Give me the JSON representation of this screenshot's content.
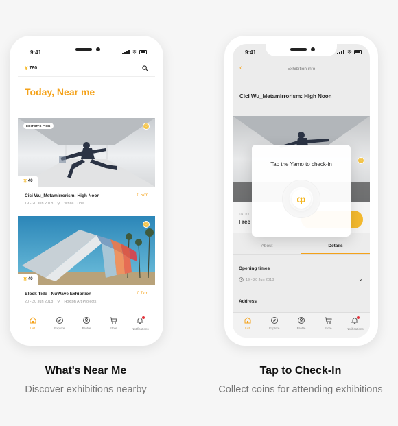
{
  "status_time": "9:41",
  "left": {
    "coins": "760",
    "heading": "Today, Near me",
    "cards": [
      {
        "badge": "EDITOR'S PICK",
        "coins": "40",
        "title": "Cici Wu_Metamirrorism: High Noon",
        "distance": "0.5km",
        "dates": "19 - 20 Jun 2018",
        "venue": "White Cube"
      },
      {
        "coins": "40",
        "title": "Block Tide : NuWave Exhibition",
        "distance": "0.7km",
        "dates": "20 - 30 Jun 2018",
        "venue": "Hoxton Art Projects"
      }
    ]
  },
  "tabs": [
    "List",
    "Explore",
    "Profile",
    "Store",
    "Notifications"
  ],
  "right": {
    "header": "Exhibition info",
    "title": "Cici Wu_Metamirrorism: High Noon",
    "entry_label": "ENTRY",
    "entry_value": "Free",
    "checkin_prompt": "Tap the Yamo to check-in",
    "tabs": [
      "About",
      "Details"
    ],
    "opening_label": "Opening times",
    "opening_value": "19 - 20 Jun 2018",
    "address_label": "Address"
  },
  "captions": {
    "left_title": "What's Near Me",
    "left_sub": "Discover exhibitions nearby",
    "right_title": "Tap to Check-In",
    "right_sub": "Collect coins for attending exhibitions"
  },
  "colors": {
    "accent": "#f4a21a",
    "coin": "#f4b41a",
    "notification_dot": "#e3343c"
  },
  "icons": [
    "coin-icon",
    "search-icon",
    "heart-icon",
    "pin-icon",
    "clock-icon",
    "back-icon",
    "chevron-down-icon",
    "list-icon",
    "explore-icon",
    "profile-icon",
    "store-icon",
    "bell-icon"
  ]
}
